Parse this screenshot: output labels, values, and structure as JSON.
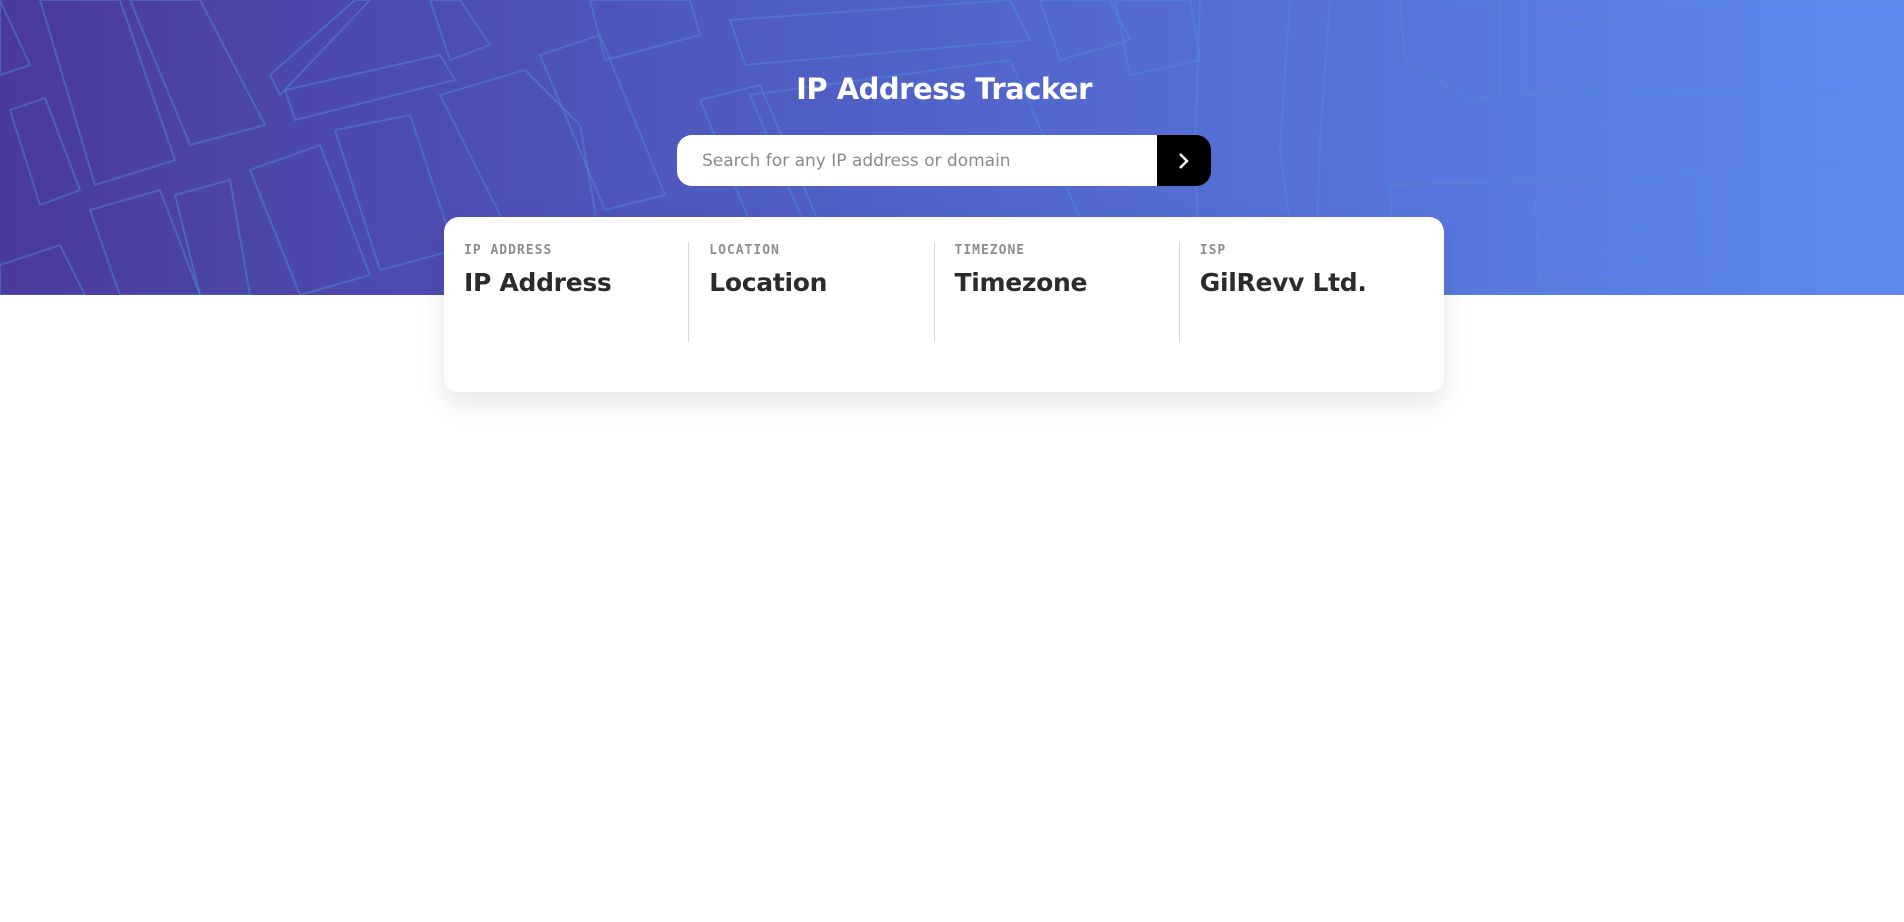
{
  "header": {
    "title": "IP Address Tracker"
  },
  "search": {
    "placeholder": "Search for any IP address or domain",
    "value": "",
    "button_icon": "chevron-right-icon"
  },
  "stats": [
    {
      "label": "IP ADDRESS",
      "value": "IP Address"
    },
    {
      "label": "LOCATION",
      "value": "Location"
    },
    {
      "label": "TIMEZONE",
      "value": "Timezone"
    },
    {
      "label": "ISP",
      "value": "GilRevv Ltd."
    }
  ],
  "colors": {
    "gradient_start": "#4a3a9c",
    "gradient_end": "#5e89f1",
    "button": "#000000",
    "label": "#8e8e8e",
    "value": "#2b2b2b"
  }
}
